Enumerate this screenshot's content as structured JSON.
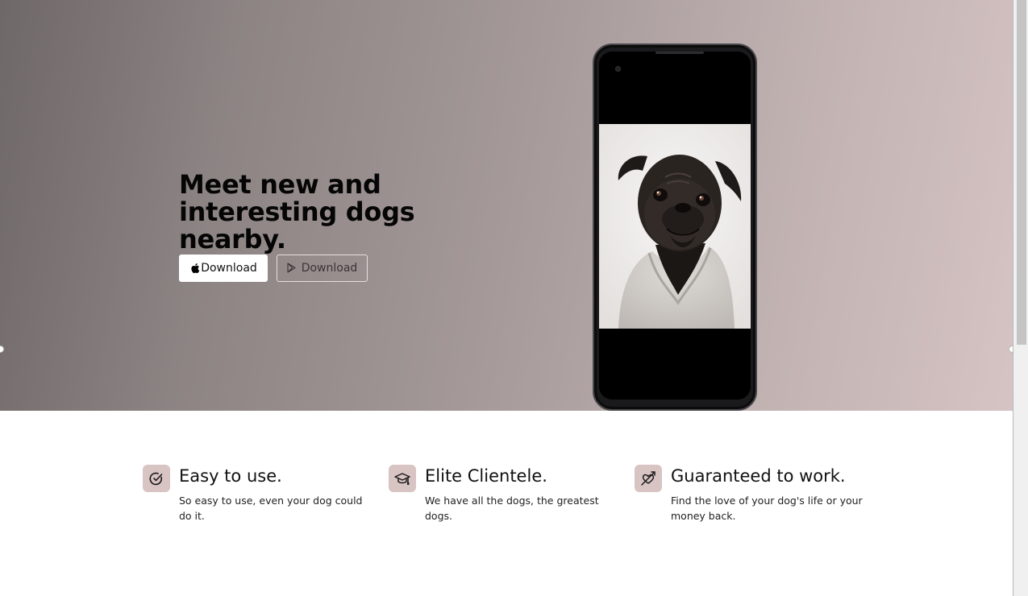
{
  "hero": {
    "title": "Meet new and interesting dogs nearby.",
    "apple_button_label": "Download",
    "play_button_label": "Download"
  },
  "features": [
    {
      "icon": "check-circle-icon",
      "title": "Easy to use.",
      "text": "So easy to use, even your dog could do it."
    },
    {
      "icon": "graduation-cap-icon",
      "title": "Elite Clientele.",
      "text": "We have all the dogs, the greatest dogs."
    },
    {
      "icon": "heart-arrow-icon",
      "title": "Guaranteed to work.",
      "text": "Find the love of your dog's life or your money back."
    }
  ],
  "colors": {
    "hero_gradient_start": "#6f6868",
    "hero_gradient_end": "#d6c3c3",
    "icon_box": "#d9c4c4"
  }
}
